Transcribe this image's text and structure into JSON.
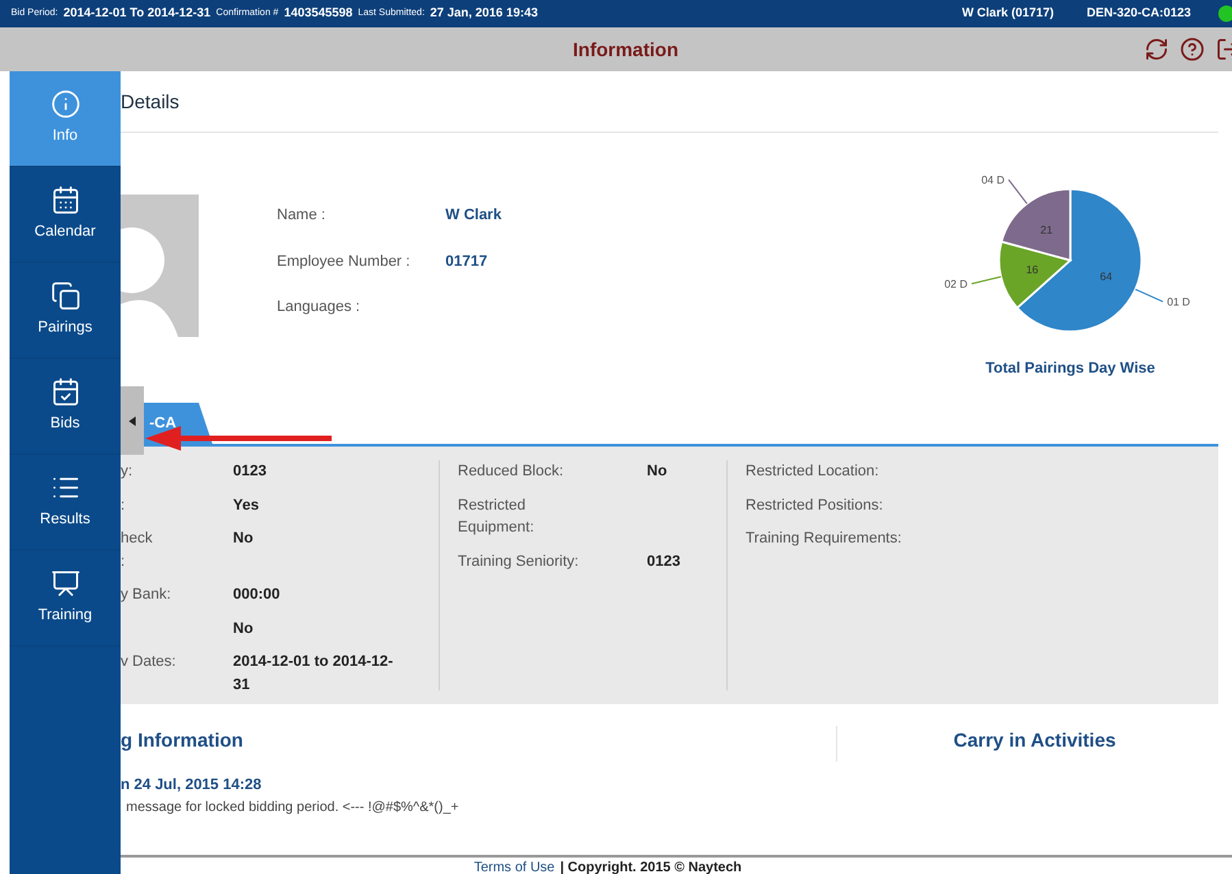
{
  "top_bar": {
    "bid_period_label": "Bid Period:",
    "bid_period": "2014-12-01 To 2014-12-31",
    "confirmation_label": "Confirmation #",
    "confirmation": "1403545598",
    "submitted_label": "Last Submitted:",
    "submitted": "27 Jan, 2016 19:43",
    "user": "W Clark (01717)",
    "base": "DEN-320-CA:0123",
    "status": {
      "color": "#22c322"
    }
  },
  "title_bar": {
    "title": "Information"
  },
  "sidebar": {
    "items": [
      {
        "label": "Info",
        "selected": true
      },
      {
        "label": "Calendar",
        "selected": false
      },
      {
        "label": "Pairings",
        "selected": false
      },
      {
        "label": "Bids",
        "selected": false
      },
      {
        "label": "Results",
        "selected": false
      },
      {
        "label": "Training",
        "selected": false
      }
    ]
  },
  "details": {
    "heading": "Details",
    "fields": [
      {
        "label": "Name :",
        "value": "W Clark"
      },
      {
        "label": "Employee Number :",
        "value": "01717"
      },
      {
        "label": "Languages :"
      }
    ]
  },
  "chart": {
    "chart_data": {
      "type": "pie",
      "title": "Total Pairings Day Wise",
      "categories": [
        "01 D",
        "02 D",
        "04 D"
      ],
      "values": [
        64,
        16,
        21
      ],
      "colors": [
        "#2f86c9",
        "#6aa528",
        "#7e6a8c"
      ],
      "data_labels": true
    }
  },
  "tab": {
    "label": "-CA",
    "selected": true
  },
  "info_columns": [
    {
      "rows": [
        {
          "label": "y:",
          "value": "0123"
        },
        {
          "label": ":",
          "value": "Yes"
        },
        {
          "label": "heck\n:",
          "value": "No"
        },
        {
          "label": "y Bank:",
          "value": "000:00"
        },
        {
          "value": "No"
        },
        {
          "label": "v Dates:",
          "value": "2014-12-01 to 2014-12-31"
        }
      ]
    },
    {
      "rows": [
        {
          "label": "Reduced Block:",
          "value": "No"
        },
        {
          "label": "Restricted Equipment:"
        },
        {
          "label": "Training Seniority:",
          "value": "0123"
        }
      ]
    },
    {
      "rows": [
        {
          "label": "Restricted Location:"
        },
        {
          "label": "Restricted Positions:"
        },
        {
          "label": "Training Requirements:"
        }
      ]
    }
  ],
  "bidding": {
    "heading": "g Information",
    "date": "n 24 Jul, 2015 14:28",
    "message": "message for locked bidding period. <--- !@#$%^&*()_+"
  },
  "carry_in": {
    "heading": "Carry in Activities"
  },
  "footer": {
    "link": "Terms of Use",
    "copyright": "| Copyright. 2015 © Naytech"
  }
}
